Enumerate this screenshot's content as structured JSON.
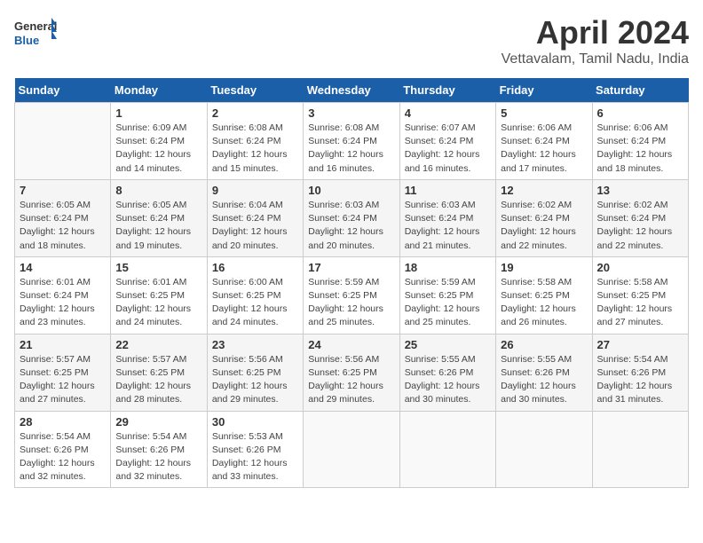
{
  "header": {
    "logo_line1": "General",
    "logo_line2": "Blue",
    "title": "April 2024",
    "subtitle": "Vettavalam, Tamil Nadu, India"
  },
  "calendar": {
    "days_of_week": [
      "Sunday",
      "Monday",
      "Tuesday",
      "Wednesday",
      "Thursday",
      "Friday",
      "Saturday"
    ],
    "weeks": [
      [
        {
          "day": "",
          "empty": true
        },
        {
          "day": "1",
          "sunrise": "6:09 AM",
          "sunset": "6:24 PM",
          "daylight": "12 hours and 14 minutes."
        },
        {
          "day": "2",
          "sunrise": "6:08 AM",
          "sunset": "6:24 PM",
          "daylight": "12 hours and 15 minutes."
        },
        {
          "day": "3",
          "sunrise": "6:08 AM",
          "sunset": "6:24 PM",
          "daylight": "12 hours and 16 minutes."
        },
        {
          "day": "4",
          "sunrise": "6:07 AM",
          "sunset": "6:24 PM",
          "daylight": "12 hours and 16 minutes."
        },
        {
          "day": "5",
          "sunrise": "6:06 AM",
          "sunset": "6:24 PM",
          "daylight": "12 hours and 17 minutes."
        },
        {
          "day": "6",
          "sunrise": "6:06 AM",
          "sunset": "6:24 PM",
          "daylight": "12 hours and 18 minutes."
        }
      ],
      [
        {
          "day": "7",
          "sunrise": "6:05 AM",
          "sunset": "6:24 PM",
          "daylight": "12 hours and 18 minutes."
        },
        {
          "day": "8",
          "sunrise": "6:05 AM",
          "sunset": "6:24 PM",
          "daylight": "12 hours and 19 minutes."
        },
        {
          "day": "9",
          "sunrise": "6:04 AM",
          "sunset": "6:24 PM",
          "daylight": "12 hours and 20 minutes."
        },
        {
          "day": "10",
          "sunrise": "6:03 AM",
          "sunset": "6:24 PM",
          "daylight": "12 hours and 20 minutes."
        },
        {
          "day": "11",
          "sunrise": "6:03 AM",
          "sunset": "6:24 PM",
          "daylight": "12 hours and 21 minutes."
        },
        {
          "day": "12",
          "sunrise": "6:02 AM",
          "sunset": "6:24 PM",
          "daylight": "12 hours and 22 minutes."
        },
        {
          "day": "13",
          "sunrise": "6:02 AM",
          "sunset": "6:24 PM",
          "daylight": "12 hours and 22 minutes."
        }
      ],
      [
        {
          "day": "14",
          "sunrise": "6:01 AM",
          "sunset": "6:24 PM",
          "daylight": "12 hours and 23 minutes."
        },
        {
          "day": "15",
          "sunrise": "6:01 AM",
          "sunset": "6:25 PM",
          "daylight": "12 hours and 24 minutes."
        },
        {
          "day": "16",
          "sunrise": "6:00 AM",
          "sunset": "6:25 PM",
          "daylight": "12 hours and 24 minutes."
        },
        {
          "day": "17",
          "sunrise": "5:59 AM",
          "sunset": "6:25 PM",
          "daylight": "12 hours and 25 minutes."
        },
        {
          "day": "18",
          "sunrise": "5:59 AM",
          "sunset": "6:25 PM",
          "daylight": "12 hours and 25 minutes."
        },
        {
          "day": "19",
          "sunrise": "5:58 AM",
          "sunset": "6:25 PM",
          "daylight": "12 hours and 26 minutes."
        },
        {
          "day": "20",
          "sunrise": "5:58 AM",
          "sunset": "6:25 PM",
          "daylight": "12 hours and 27 minutes."
        }
      ],
      [
        {
          "day": "21",
          "sunrise": "5:57 AM",
          "sunset": "6:25 PM",
          "daylight": "12 hours and 27 minutes."
        },
        {
          "day": "22",
          "sunrise": "5:57 AM",
          "sunset": "6:25 PM",
          "daylight": "12 hours and 28 minutes."
        },
        {
          "day": "23",
          "sunrise": "5:56 AM",
          "sunset": "6:25 PM",
          "daylight": "12 hours and 29 minutes."
        },
        {
          "day": "24",
          "sunrise": "5:56 AM",
          "sunset": "6:25 PM",
          "daylight": "12 hours and 29 minutes."
        },
        {
          "day": "25",
          "sunrise": "5:55 AM",
          "sunset": "6:26 PM",
          "daylight": "12 hours and 30 minutes."
        },
        {
          "day": "26",
          "sunrise": "5:55 AM",
          "sunset": "6:26 PM",
          "daylight": "12 hours and 30 minutes."
        },
        {
          "day": "27",
          "sunrise": "5:54 AM",
          "sunset": "6:26 PM",
          "daylight": "12 hours and 31 minutes."
        }
      ],
      [
        {
          "day": "28",
          "sunrise": "5:54 AM",
          "sunset": "6:26 PM",
          "daylight": "12 hours and 32 minutes."
        },
        {
          "day": "29",
          "sunrise": "5:54 AM",
          "sunset": "6:26 PM",
          "daylight": "12 hours and 32 minutes."
        },
        {
          "day": "30",
          "sunrise": "5:53 AM",
          "sunset": "6:26 PM",
          "daylight": "12 hours and 33 minutes."
        },
        {
          "day": "",
          "empty": true
        },
        {
          "day": "",
          "empty": true
        },
        {
          "day": "",
          "empty": true
        },
        {
          "day": "",
          "empty": true
        }
      ]
    ]
  }
}
